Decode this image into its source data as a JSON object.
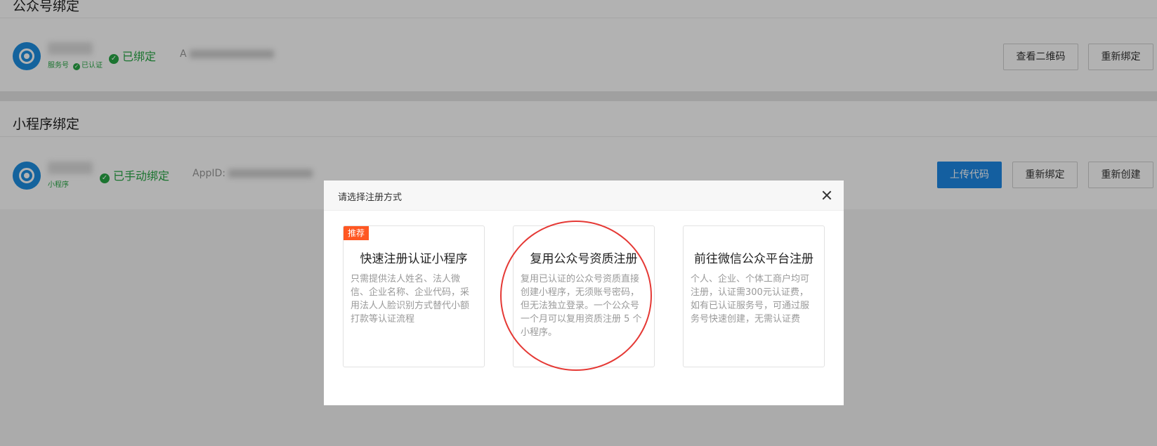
{
  "oa_section": {
    "title": "公众号绑定",
    "account": {
      "sub_type": "服务号",
      "verified_tag": "已认证",
      "status": "已绑定",
      "appid_prefix": "A"
    },
    "buttons": {
      "view_qr": "查看二维码",
      "rebind": "重新绑定"
    }
  },
  "mp_section": {
    "title": "小程序绑定",
    "account": {
      "sub_type": "小程序",
      "status": "已手动绑定",
      "appid_prefix": "AppID:"
    },
    "buttons": {
      "upload_code": "上传代码",
      "rebind": "重新绑定",
      "recreate": "重新创建"
    }
  },
  "dialog": {
    "title": "请选择注册方式",
    "cards": [
      {
        "badge": "推荐",
        "title": "快速注册认证小程序",
        "desc": "只需提供法人姓名、法人微信、企业名称、企业代码，采用法人人脸识别方式替代小额打款等认证流程"
      },
      {
        "title": "复用公众号资质注册",
        "desc": "复用已认证的公众号资质直接创建小程序，无须账号密码，但无法独立登录。一个公众号一个月可以复用资质注册 5 个小程序。"
      },
      {
        "title": "前往微信公众平台注册",
        "desc": "个人、企业、个体工商户均可注册，认证需300元认证费，如有已认证服务号，可通过服务号快速创建，无需认证费"
      }
    ]
  },
  "colors": {
    "primary": "#1e88e5",
    "success": "#28a745",
    "badge": "#ff5722",
    "annotation": "#e53935"
  }
}
